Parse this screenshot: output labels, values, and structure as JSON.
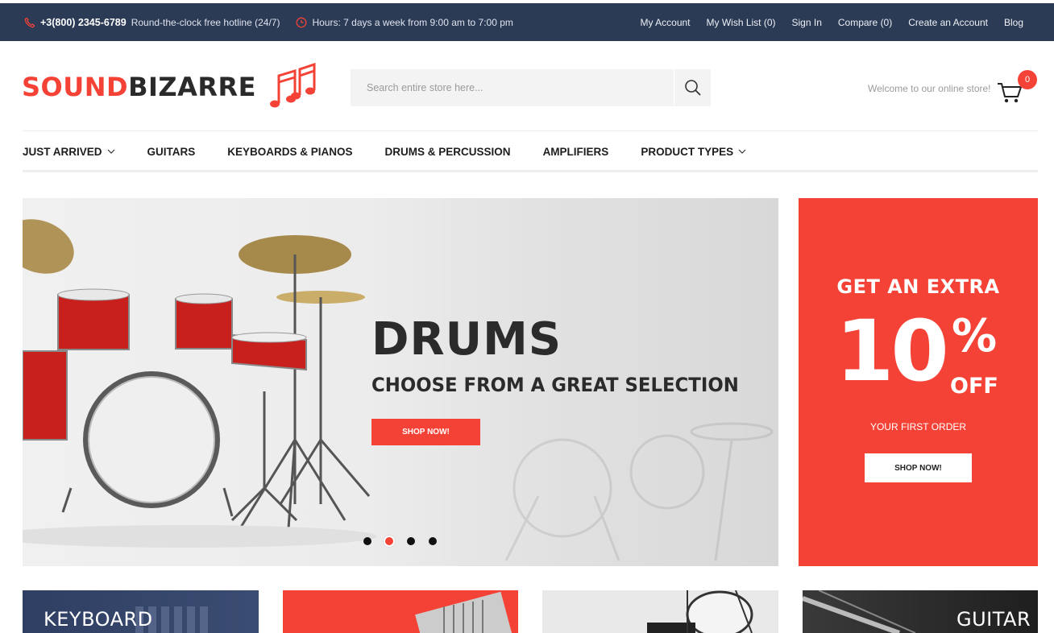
{
  "topbar": {
    "phone": "+3(800) 2345-6789",
    "hotline": "Round-the-clock free hotline (24/7)",
    "hours": "Hours: 7 days a week from 9:00 am to 7:00 pm",
    "links": [
      "My Account",
      "My Wish List (0)",
      "Sign In",
      "Compare (0)",
      "Create an Account",
      "Blog"
    ],
    "bg_color": "#2b3a55"
  },
  "header": {
    "logo_part1": "SOUND",
    "logo_part2": "BIZARRE",
    "search_placeholder": "Search entire store here...",
    "welcome": "Welcome to our online store!",
    "cart_count": "0",
    "accent_color": "#f44336"
  },
  "nav": {
    "items": [
      {
        "label": "JUST ARRIVED",
        "has_dropdown": true
      },
      {
        "label": "GUITARS",
        "has_dropdown": false
      },
      {
        "label": "KEYBOARDS & PIANOS",
        "has_dropdown": false
      },
      {
        "label": "DRUMS & PERCUSSION",
        "has_dropdown": false
      },
      {
        "label": "AMPLIFIERS",
        "has_dropdown": false
      },
      {
        "label": "PRODUCT TYPES",
        "has_dropdown": true
      }
    ]
  },
  "hero": {
    "title": "DRUMS",
    "subtitle": "CHOOSE FROM A GREAT SELECTION",
    "button": "SHOP NOW!",
    "slides": 4,
    "active_slide": 2
  },
  "promo": {
    "line1": "GET AN EXTRA",
    "big": "10",
    "percent": "%",
    "off": "OFF",
    "line3": "YOUR FIRST ORDER",
    "button": "SHOP NOW!"
  },
  "categories": [
    {
      "label": "KEYBOARD"
    },
    {
      "label": ""
    },
    {
      "label": ""
    },
    {
      "label": "GUITAR"
    }
  ]
}
